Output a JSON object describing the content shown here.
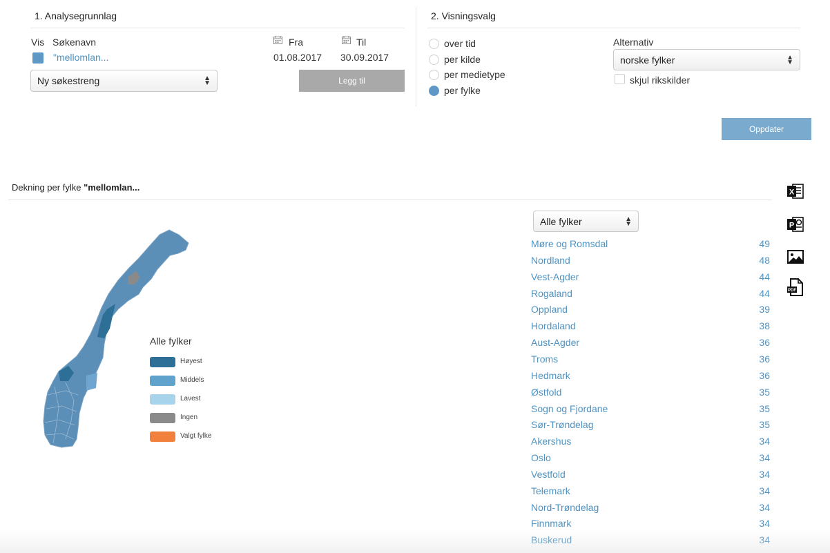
{
  "analysis": {
    "title": "1. Analysegrunnlag",
    "col_vis": "Vis",
    "col_name": "Søkenavn",
    "col_from": "Fra",
    "col_to": "Til",
    "query_name": "\"mellomlan...",
    "query_color": "#5f98c6",
    "from_date": "01.08.2017",
    "to_date": "30.09.2017",
    "new_query_select": "Ny søkestreng",
    "add_button": "Legg til"
  },
  "view": {
    "title": "2. Visningsvalg",
    "options": [
      {
        "label": "over tid",
        "selected": false
      },
      {
        "label": "per kilde",
        "selected": false
      },
      {
        "label": "per medietype",
        "selected": false
      },
      {
        "label": "per fylke",
        "selected": true
      }
    ],
    "alternative_label": "Alternativ",
    "alternative_select": "norske fylker",
    "hide_checkbox_label": "skjul rikskilder",
    "hide_checked": false,
    "update_button": "Oppdater"
  },
  "result": {
    "title_prefix": "Dekning per fylke ",
    "title_query": "\"mellomlan...",
    "county_select": "Alle fylker",
    "legend": {
      "title": "Alle fylker",
      "items": [
        {
          "label": "Høyest",
          "color": "#2d6f96"
        },
        {
          "label": "Middels",
          "color": "#5fa2cc"
        },
        {
          "label": "Lavest",
          "color": "#a7d4ea"
        },
        {
          "label": "Ingen",
          "color": "#8a8a8a"
        },
        {
          "label": "Valgt fylke",
          "color": "#f0803c"
        }
      ]
    },
    "counties": [
      {
        "name": "Møre og Romsdal",
        "count": "49"
      },
      {
        "name": "Nordland",
        "count": "48"
      },
      {
        "name": "Vest-Agder",
        "count": "44"
      },
      {
        "name": "Rogaland",
        "count": "44"
      },
      {
        "name": "Oppland",
        "count": "39"
      },
      {
        "name": "Hordaland",
        "count": "38"
      },
      {
        "name": "Aust-Agder",
        "count": "36"
      },
      {
        "name": "Troms",
        "count": "36"
      },
      {
        "name": "Hedmark",
        "count": "36"
      },
      {
        "name": "Østfold",
        "count": "35"
      },
      {
        "name": "Sogn og Fjordane",
        "count": "35"
      },
      {
        "name": "Sør-Trøndelag",
        "count": "35"
      },
      {
        "name": "Akershus",
        "count": "34"
      },
      {
        "name": "Oslo",
        "count": "34"
      },
      {
        "name": "Vestfold",
        "count": "34"
      },
      {
        "name": "Telemark",
        "count": "34"
      },
      {
        "name": "Nord-Trøndelag",
        "count": "34"
      },
      {
        "name": "Finnmark",
        "count": "34"
      },
      {
        "name": "Buskerud",
        "count": "34"
      }
    ]
  },
  "exports": [
    {
      "icon": "excel-icon",
      "letter": "X"
    },
    {
      "icon": "powerpoint-icon",
      "letter": "P"
    },
    {
      "icon": "image-icon"
    },
    {
      "icon": "pdf-icon",
      "letter": "PDF"
    }
  ],
  "colors": {
    "accent": "#5f98c6",
    "link": "#4f93c2",
    "button_disabled": "#a9a9a9",
    "button_primary": "#7aabcf"
  }
}
